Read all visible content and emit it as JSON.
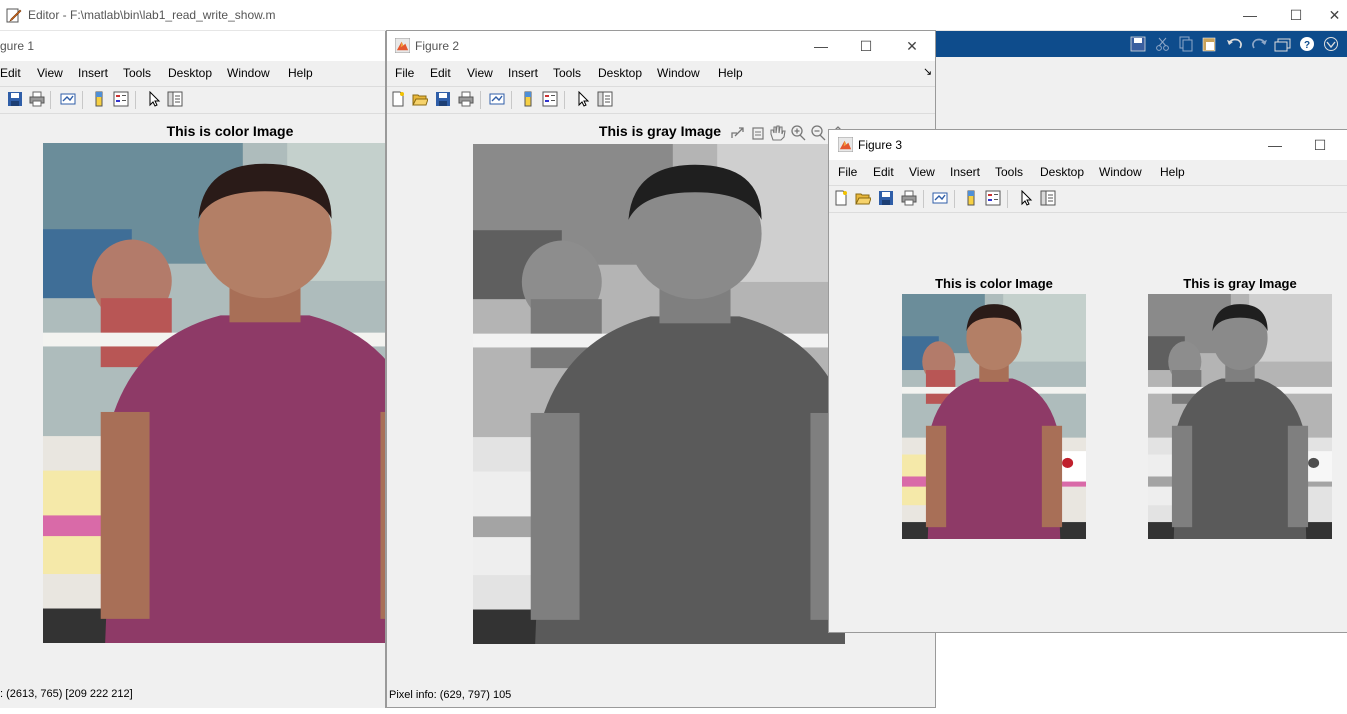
{
  "editor": {
    "title": "Editor - F:\\matlab\\bin\\lab1_read_write_show.m",
    "minimize_glyph": "—",
    "maximize_glyph": "☐",
    "close_glyph": "✕"
  },
  "figure1": {
    "title": "gure 1",
    "menus": [
      "Edit",
      "View",
      "Insert",
      "Tools",
      "Desktop",
      "Window",
      "Help"
    ],
    "axes_title": "This is color Image",
    "status": ": (2613, 765)  [209 222 212]"
  },
  "figure2": {
    "title": "Figure 2",
    "menus": [
      "File",
      "Edit",
      "View",
      "Insert",
      "Tools",
      "Desktop",
      "Window",
      "Help"
    ],
    "axes_title": "This is gray Image",
    "status": "Pixel info: (629, 797)  105",
    "minimize_glyph": "—",
    "maximize_glyph": "☐",
    "close_glyph": "✕",
    "dock_glyph": "↘"
  },
  "figure3": {
    "title": "Figure 3",
    "menus": [
      "File",
      "Edit",
      "View",
      "Insert",
      "Tools",
      "Desktop",
      "Window",
      "Help"
    ],
    "left_axes_title": "This is color Image",
    "right_axes_title": "This is gray Image",
    "minimize_glyph": "—",
    "maximize_glyph": "☐"
  },
  "colors": {
    "matlab_toolstrip": "#0e4c8c",
    "window_bg": "#f0f0f0",
    "shirt_color": "#8e3a67",
    "gray_shirt": "#5a5a5a"
  }
}
